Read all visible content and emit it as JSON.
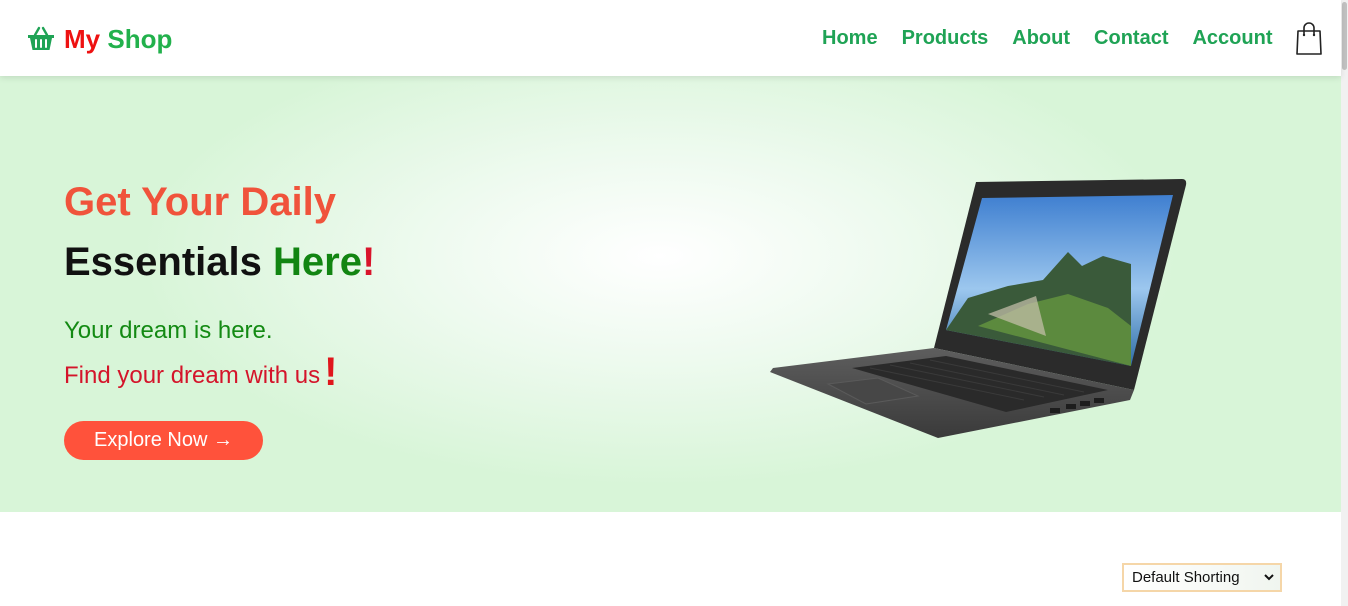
{
  "header": {
    "logo_my": "My",
    "logo_shop": "Shop",
    "nav": [
      "Home",
      "Products",
      "About",
      "Contact",
      "Account"
    ]
  },
  "hero": {
    "heading_line1": "Get Your Daily",
    "heading_essentials": "Essentials",
    "heading_here": "Here",
    "heading_bang": "!",
    "sub_line1": "Your dream is here.",
    "sub_line2": "Find your dream with us",
    "sub_bang": "!",
    "button_label": "Explore Now →"
  },
  "sort": {
    "selected": "Default Shorting"
  },
  "icons": {
    "logo": "basket-icon",
    "cart": "shopping-bag-icon",
    "sort": "chevron-down-icon"
  },
  "colors": {
    "accent": "#ff523b",
    "brand_green": "#1fa355",
    "brand_red": "#ee1111"
  }
}
